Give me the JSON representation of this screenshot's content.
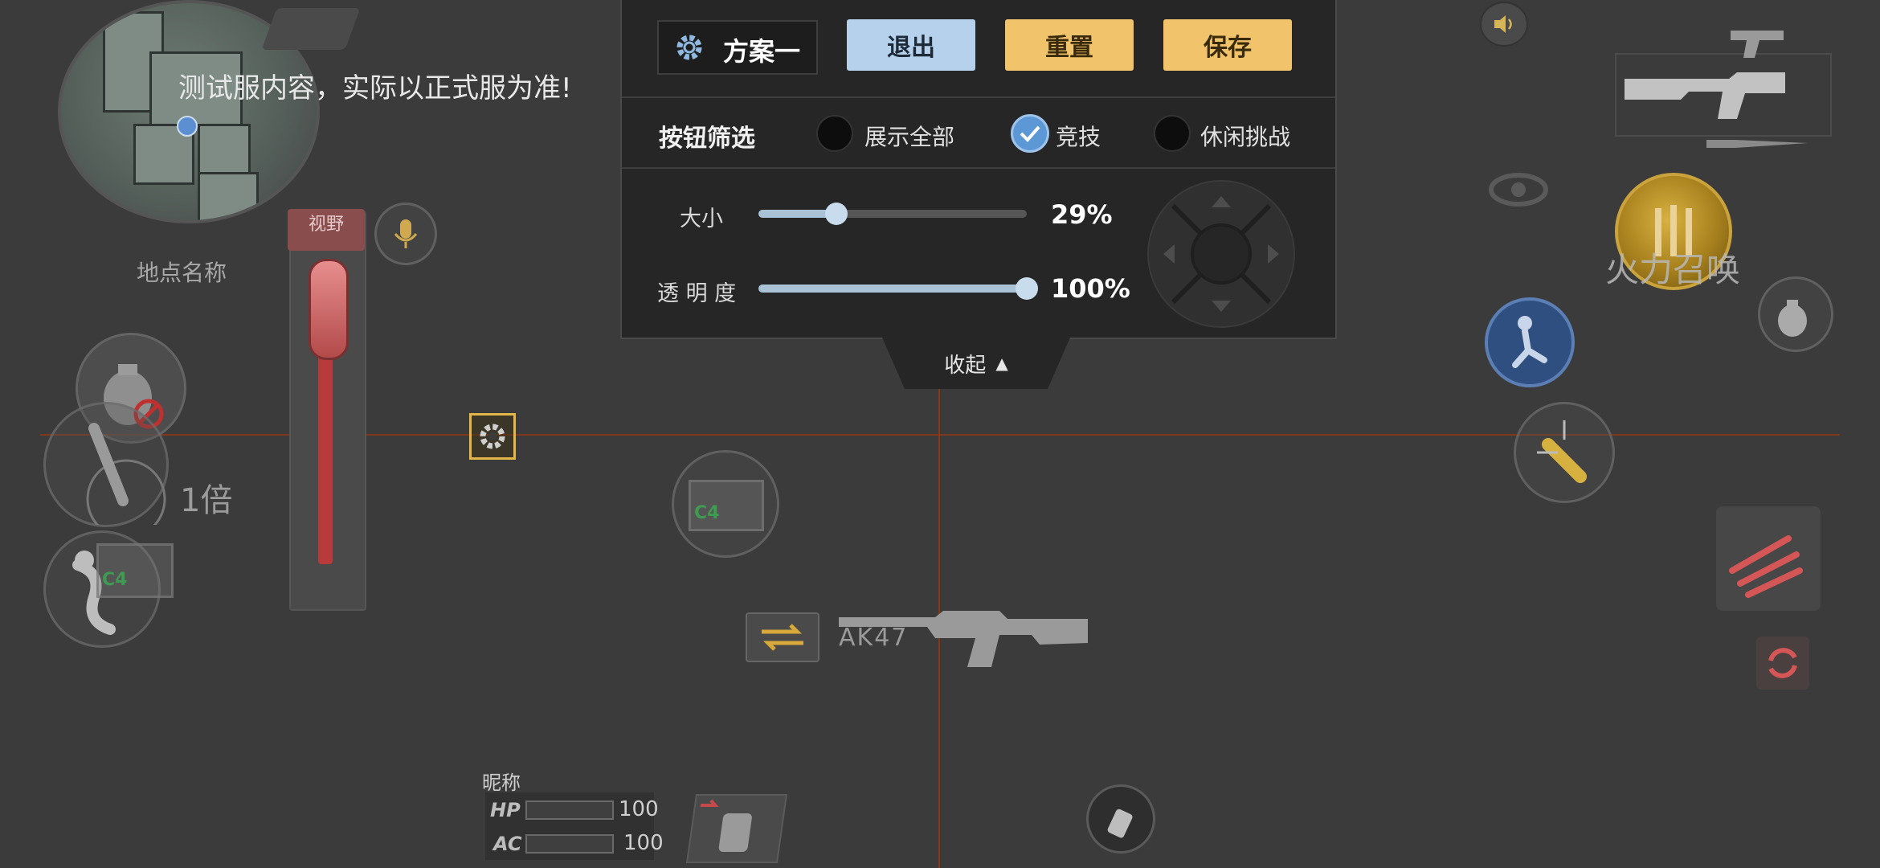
{
  "notice": "测试服内容，实际以正式服为准!",
  "minimap": {
    "place_name": "地点名称"
  },
  "panel": {
    "plan_name": "方案一",
    "buttons": {
      "exit": "退出",
      "reset": "重置",
      "save": "保存"
    },
    "filter": {
      "label": "按钮筛选",
      "options": [
        {
          "label": "展示全部",
          "selected": false
        },
        {
          "label": "竞技",
          "selected": true
        },
        {
          "label": "休闲挑战",
          "selected": false
        }
      ]
    },
    "size": {
      "label": "大小",
      "value_text": "29%",
      "value": 0.29
    },
    "opacity": {
      "label": "透 明 度",
      "value_text": "100%",
      "value": 1.0
    },
    "collapse_label": "收起"
  },
  "hud": {
    "view_tag": "视野",
    "zoom_label": "1倍",
    "nickname": "昵称",
    "hp_label": "HP",
    "hp_value": "100",
    "ac_label": "AC",
    "ac_value": "100",
    "c4_label": "C4",
    "weapon_name": "AK47",
    "fire_call_label": "火力召唤"
  },
  "colors": {
    "accent_blue": "#b5d1eb",
    "accent_gold": "#f1c46c",
    "guide_line": "#8a3a1a",
    "zoom_red": "#b83b3b"
  },
  "icons": [
    "gear-icon",
    "speaker-icon",
    "mic-icon",
    "grenade-icon",
    "bullet-icon",
    "scope-icon",
    "c4-icon",
    "swap-icon",
    "rifle-icon",
    "jump-icon",
    "reload-icon",
    "spray-icon",
    "backpack-icon",
    "fire-call-icon"
  ]
}
